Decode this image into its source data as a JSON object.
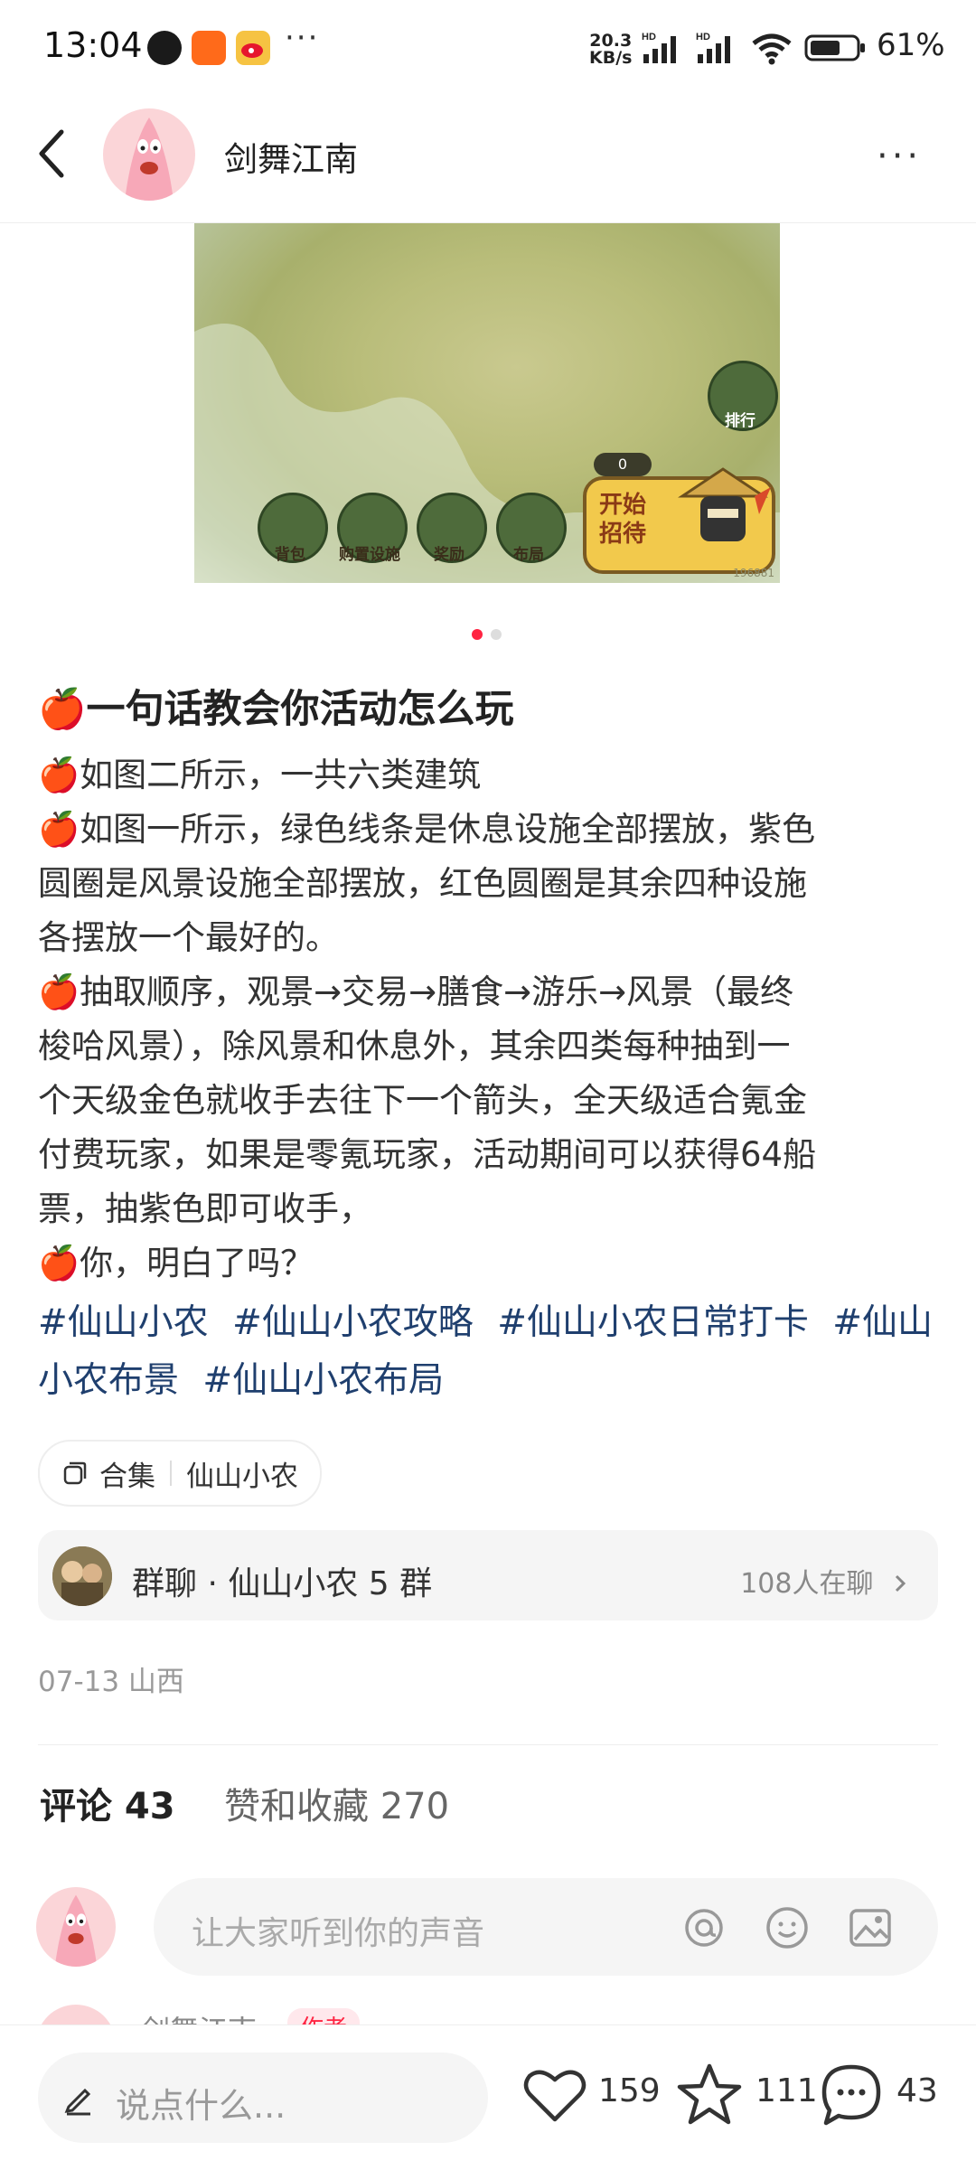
{
  "status_bar": {
    "time": "13:04",
    "more": "···",
    "net_speed_top": "20.3",
    "net_speed_bottom": "KB/s",
    "hd1": "HD",
    "hd2": "HD",
    "battery": "61%"
  },
  "header": {
    "author_name": "剑舞江南",
    "more": "···"
  },
  "hero_image": {
    "rank_label": "排行",
    "ticket_count": "0",
    "buttons": [
      "背包",
      "购置设施",
      "奖励",
      "布局"
    ],
    "start_label_1": "开始",
    "start_label_2": "招待",
    "watermark": "196881"
  },
  "post": {
    "title": "🍎一句话教会你活动怎么玩",
    "paragraphs": [
      "🍎如图二所示，一共六类建筑",
      "🍎如图一所示，绿色线条是休息设施全部摆放，紫色\n圆圈是风景设施全部摆放，红色圆圈是其余四种设施\n各摆放一个最好的。",
      "🍎抽取顺序，观景→交易→膳食→游乐→风景（最终\n梭哈风景），除风景和休息外，其余四类每种抽到一\n个天级金色就收手去往下一个箭头，全天级适合氪金\n付费玩家，如果是零氪玩家，活动期间可以获得64船\n票，抽紫色即可收手，",
      "🍎你，明白了吗？"
    ],
    "tags": [
      "#仙山小农",
      "#仙山小农攻略",
      "#仙山小农日常打卡",
      "#仙山小农布景",
      "#仙山小农布局"
    ]
  },
  "collection": {
    "label": "合集",
    "name": "仙山小农"
  },
  "group_chat": {
    "name": "群聊 · 仙山小农 5 群",
    "count": "108人在聊"
  },
  "meta": {
    "date_location": "07-13 山西"
  },
  "tabs": {
    "comments": "评论 43",
    "likes_collects": "赞和收藏 270"
  },
  "comment_input": {
    "placeholder": "让大家听到你的声音"
  },
  "peek_comment": {
    "name": "剑舞江南",
    "badge": "作者"
  },
  "bottom_bar": {
    "say_placeholder": "说点什么...",
    "likes": "159",
    "stars": "111",
    "comments": "43"
  },
  "colors": {
    "accent": "#ff2442",
    "tag": "#1f3f6e"
  }
}
